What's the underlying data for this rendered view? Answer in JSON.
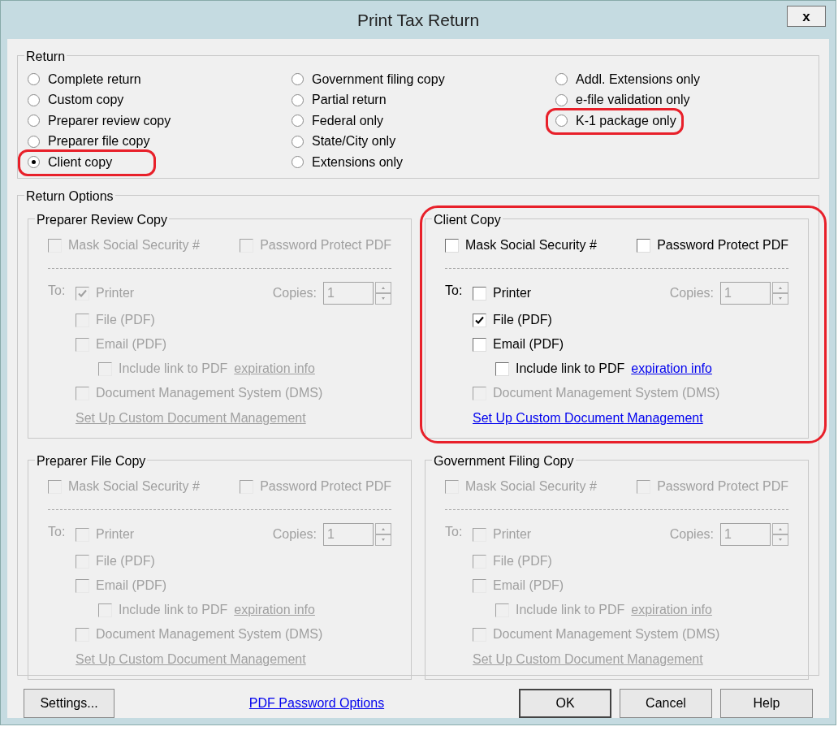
{
  "window": {
    "title": "Print Tax Return",
    "close": "x"
  },
  "return_group": {
    "title": "Return",
    "options": [
      {
        "label": "Complete return",
        "selected": false,
        "circled": false
      },
      {
        "label": "Custom copy",
        "selected": false,
        "circled": false
      },
      {
        "label": "Preparer review copy",
        "selected": false,
        "circled": false
      },
      {
        "label": "Preparer file copy",
        "selected": false,
        "circled": false
      },
      {
        "label": "Client copy",
        "selected": true,
        "circled": true
      },
      {
        "label": "Government filing copy",
        "selected": false,
        "circled": false
      },
      {
        "label": "Partial return",
        "selected": false,
        "circled": false
      },
      {
        "label": "Federal only",
        "selected": false,
        "circled": false
      },
      {
        "label": "State/City only",
        "selected": false,
        "circled": false
      },
      {
        "label": "Extensions only",
        "selected": false,
        "circled": false
      },
      {
        "label": "Addl. Extensions only",
        "selected": false,
        "circled": false
      },
      {
        "label": "e-file validation only",
        "selected": false,
        "circled": false
      },
      {
        "label": "K-1 package only",
        "selected": false,
        "circled": true
      }
    ]
  },
  "return_options": {
    "title": "Return Options",
    "groups": [
      {
        "title": "Preparer Review Copy",
        "circled": false,
        "options": [
          {
            "label": "Mask Social Security #",
            "checked": false,
            "disabled": true
          },
          {
            "label": "Password Protect PDF",
            "checked": false,
            "disabled": true
          }
        ],
        "to_label": "To:",
        "to_disabled": true,
        "destinations": [
          {
            "kind": "main",
            "label": "Printer",
            "checked": true,
            "disabled": true
          },
          {
            "kind": "main",
            "label": "File (PDF)",
            "checked": false,
            "disabled": true
          },
          {
            "kind": "main",
            "label": "Email (PDF)",
            "checked": false,
            "disabled": true
          },
          {
            "kind": "sub",
            "label": "Include link to PDF",
            "link": "expiration info",
            "checked": false,
            "disabled": true
          },
          {
            "kind": "main",
            "label": "Document Management System (DMS)",
            "checked": false,
            "disabled": true
          }
        ],
        "copies": {
          "label": "Copies:",
          "value": "1",
          "disabled": true
        },
        "setup_link": {
          "label": "Set Up Custom Document Management",
          "disabled": true
        }
      },
      {
        "title": "Client Copy",
        "circled": true,
        "options": [
          {
            "label": "Mask Social Security #",
            "checked": false,
            "disabled": false
          },
          {
            "label": "Password Protect PDF",
            "checked": false,
            "disabled": false
          }
        ],
        "to_label": "To:",
        "to_disabled": false,
        "destinations": [
          {
            "kind": "main",
            "label": "Printer",
            "checked": false,
            "disabled": false
          },
          {
            "kind": "main",
            "label": "File (PDF)",
            "checked": true,
            "disabled": false
          },
          {
            "kind": "main",
            "label": "Email (PDF)",
            "checked": false,
            "disabled": false
          },
          {
            "kind": "sub",
            "label": "Include link to PDF",
            "link": "expiration info",
            "checked": false,
            "disabled": false
          },
          {
            "kind": "main",
            "label": "Document Management System (DMS)",
            "checked": false,
            "disabled": true
          }
        ],
        "copies": {
          "label": "Copies:",
          "value": "1",
          "disabled": true
        },
        "setup_link": {
          "label": "Set Up Custom Document Management",
          "disabled": false
        }
      },
      {
        "title": "Preparer File Copy",
        "circled": false,
        "options": [
          {
            "label": "Mask Social Security #",
            "checked": false,
            "disabled": true
          },
          {
            "label": "Password Protect PDF",
            "checked": false,
            "disabled": true
          }
        ],
        "to_label": "To:",
        "to_disabled": true,
        "destinations": [
          {
            "kind": "main",
            "label": "Printer",
            "checked": false,
            "disabled": true
          },
          {
            "kind": "main",
            "label": "File (PDF)",
            "checked": false,
            "disabled": true
          },
          {
            "kind": "main",
            "label": "Email (PDF)",
            "checked": false,
            "disabled": true
          },
          {
            "kind": "sub",
            "label": "Include link to PDF",
            "link": "expiration info",
            "checked": false,
            "disabled": true
          },
          {
            "kind": "main",
            "label": "Document Management System (DMS)",
            "checked": false,
            "disabled": true
          }
        ],
        "copies": {
          "label": "Copies:",
          "value": "1",
          "disabled": true
        },
        "setup_link": {
          "label": "Set Up Custom Document Management",
          "disabled": true
        }
      },
      {
        "title": "Government Filing Copy",
        "circled": false,
        "options": [
          {
            "label": "Mask Social Security #",
            "checked": false,
            "disabled": true
          },
          {
            "label": "Password Protect PDF",
            "checked": false,
            "disabled": true
          }
        ],
        "to_label": "To:",
        "to_disabled": true,
        "destinations": [
          {
            "kind": "main",
            "label": "Printer",
            "checked": false,
            "disabled": true
          },
          {
            "kind": "main",
            "label": "File (PDF)",
            "checked": false,
            "disabled": true
          },
          {
            "kind": "main",
            "label": "Email (PDF)",
            "checked": false,
            "disabled": true
          },
          {
            "kind": "sub",
            "label": "Include link to PDF",
            "link": "expiration info",
            "checked": false,
            "disabled": true
          },
          {
            "kind": "main",
            "label": "Document Management System (DMS)",
            "checked": false,
            "disabled": true
          }
        ],
        "copies": {
          "label": "Copies:",
          "value": "1",
          "disabled": true
        },
        "setup_link": {
          "label": "Set Up Custom Document Management",
          "disabled": true
        }
      }
    ]
  },
  "footer": {
    "settings_button": "Settings...",
    "password_link": "PDF Password Options",
    "buttons": [
      {
        "label": "OK",
        "default": true
      },
      {
        "label": "Cancel",
        "default": false
      },
      {
        "label": "Help",
        "default": false
      }
    ]
  }
}
